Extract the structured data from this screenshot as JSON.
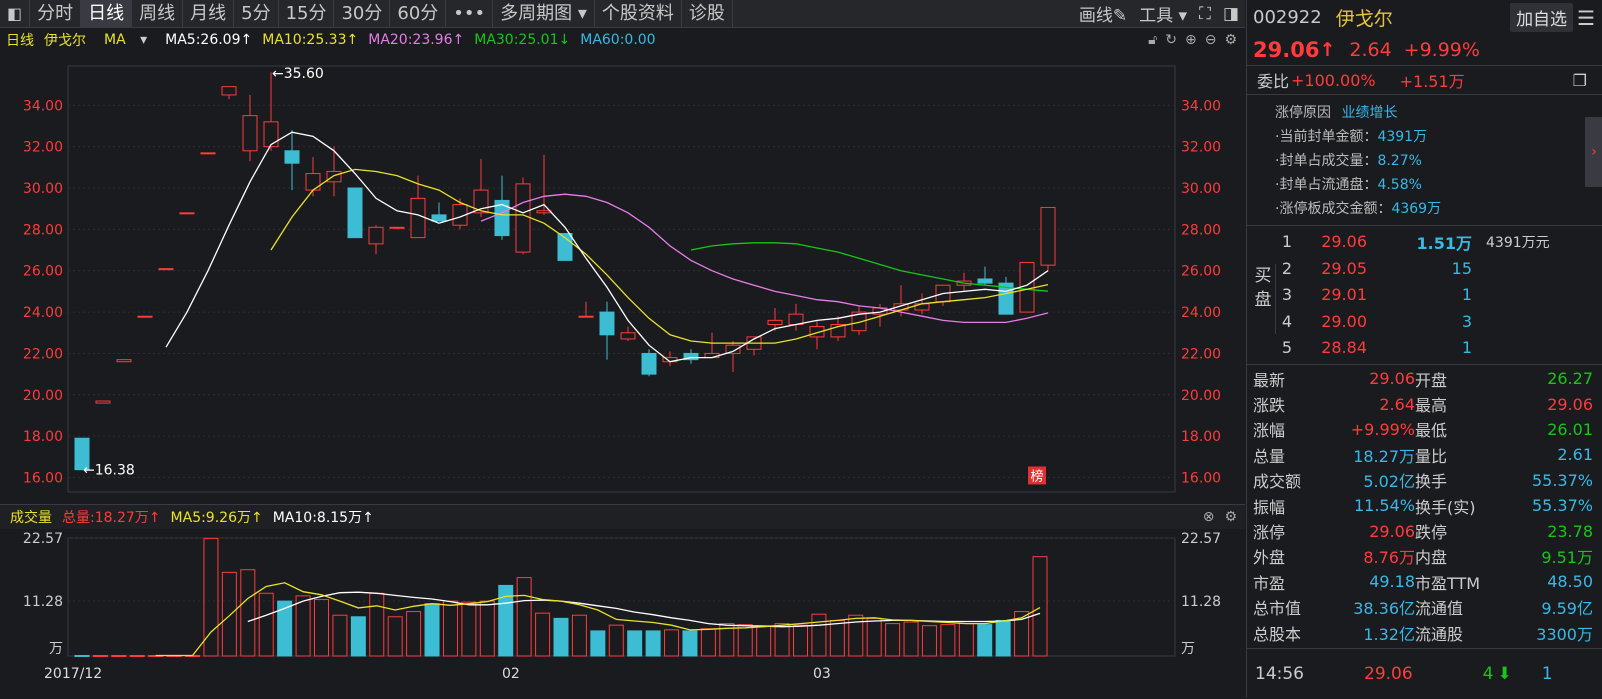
{
  "toolbar": {
    "tabs": [
      "分时",
      "日线",
      "周线",
      "月线",
      "5分",
      "15分",
      "30分",
      "60分",
      "•••",
      "多周期图 ▾",
      "个股资料",
      "诊股"
    ],
    "active": 1,
    "draw": "画线✎",
    "tools": "工具 ▾"
  },
  "ma_bar": {
    "period": "日线",
    "name": "伊戈尔",
    "ma_label": "MA",
    "ma5": "MA5:26.09↑",
    "ma10": "MA10:25.33↑",
    "ma20": "MA20:23.96↑",
    "ma30": "MA30:25.01↓",
    "ma60": "MA60:0.00"
  },
  "vol_bar": {
    "label": "成交量",
    "total": "总量:18.27万↑",
    "ma5": "MA5:9.26万↑",
    "ma10": "MA10:8.15万↑"
  },
  "colors": {
    "up": "#ff3b3b",
    "down": "#3dbdd4",
    "ma5": "#ffffff",
    "ma10": "#e8e22a",
    "ma20": "#e87ce8",
    "ma30": "#19c519"
  },
  "chart_data": {
    "type": "candlestick",
    "price_ticks": [
      "34.00",
      "32.00",
      "30.00",
      "28.00",
      "26.00",
      "24.00",
      "22.00",
      "20.00",
      "18.00",
      "16.00"
    ],
    "ylim": [
      15.3,
      35.9
    ],
    "high_label": "←35.60",
    "low_label": "←16.38",
    "x_labels": [
      "2017/12",
      "02",
      "03"
    ],
    "badge": "榜",
    "candles": [
      {
        "o": 17.9,
        "c": 16.38,
        "h": 17.9,
        "l": 16.38
      },
      {
        "o": 19.6,
        "c": 19.7,
        "h": 19.7,
        "l": 19.6
      },
      {
        "o": 21.6,
        "c": 21.7,
        "h": 21.7,
        "l": 21.6
      },
      {
        "o": 23.8,
        "c": 23.8,
        "h": 23.8,
        "l": 23.8
      },
      {
        "o": 26.1,
        "c": 26.1,
        "h": 26.1,
        "l": 26.1
      },
      {
        "o": 28.8,
        "c": 28.8,
        "h": 28.8,
        "l": 28.8
      },
      {
        "o": 31.7,
        "c": 31.7,
        "h": 31.7,
        "l": 31.7
      },
      {
        "o": 34.5,
        "c": 34.9,
        "h": 34.9,
        "l": 34.3
      },
      {
        "o": 31.8,
        "c": 33.5,
        "h": 34.5,
        "l": 31.3
      },
      {
        "o": 32.0,
        "c": 33.2,
        "h": 35.6,
        "l": 31.8
      },
      {
        "o": 31.8,
        "c": 31.2,
        "h": 32.8,
        "l": 29.9
      },
      {
        "o": 29.9,
        "c": 30.7,
        "h": 31.5,
        "l": 29.6
      },
      {
        "o": 30.3,
        "c": 30.8,
        "h": 32.0,
        "l": 29.6
      },
      {
        "o": 30.0,
        "c": 27.6,
        "h": 30.0,
        "l": 27.6
      },
      {
        "o": 27.3,
        "c": 28.1,
        "h": 28.2,
        "l": 26.8
      },
      {
        "o": 28.1,
        "c": 28.1,
        "h": 28.1,
        "l": 28.0
      },
      {
        "o": 27.6,
        "c": 29.5,
        "h": 30.6,
        "l": 27.6
      },
      {
        "o": 28.7,
        "c": 28.4,
        "h": 29.3,
        "l": 28.4
      },
      {
        "o": 28.2,
        "c": 29.2,
        "h": 29.5,
        "l": 28.0
      },
      {
        "o": 28.8,
        "c": 29.9,
        "h": 31.4,
        "l": 28.6
      },
      {
        "o": 29.4,
        "c": 27.7,
        "h": 30.6,
        "l": 27.5
      },
      {
        "o": 26.9,
        "c": 30.2,
        "h": 30.5,
        "l": 26.8
      },
      {
        "o": 28.8,
        "c": 28.9,
        "h": 31.6,
        "l": 28.7
      },
      {
        "o": 27.8,
        "c": 26.5,
        "h": 27.8,
        "l": 26.5
      },
      {
        "o": 23.8,
        "c": 23.8,
        "h": 24.5,
        "l": 23.8
      },
      {
        "o": 24.0,
        "c": 22.9,
        "h": 24.5,
        "l": 21.7
      },
      {
        "o": 22.7,
        "c": 23.0,
        "h": 23.3,
        "l": 22.6
      },
      {
        "o": 22.0,
        "c": 21.0,
        "h": 22.2,
        "l": 20.9
      },
      {
        "o": 21.6,
        "c": 21.8,
        "h": 22.1,
        "l": 21.4
      },
      {
        "o": 22.0,
        "c": 21.7,
        "h": 22.2,
        "l": 21.5
      },
      {
        "o": 21.8,
        "c": 22.0,
        "h": 23.0,
        "l": 21.8
      },
      {
        "o": 22.0,
        "c": 22.4,
        "h": 22.6,
        "l": 21.1
      },
      {
        "o": 22.2,
        "c": 22.8,
        "h": 22.8,
        "l": 21.9
      },
      {
        "o": 23.4,
        "c": 23.6,
        "h": 24.2,
        "l": 23.1
      },
      {
        "o": 23.4,
        "c": 23.9,
        "h": 24.4,
        "l": 23.1
      },
      {
        "o": 22.8,
        "c": 23.3,
        "h": 23.6,
        "l": 22.2
      },
      {
        "o": 22.8,
        "c": 23.4,
        "h": 23.8,
        "l": 22.6
      },
      {
        "o": 23.1,
        "c": 24.0,
        "h": 24.3,
        "l": 22.9
      },
      {
        "o": 23.9,
        "c": 24.2,
        "h": 24.4,
        "l": 23.3
      },
      {
        "o": 24.1,
        "c": 24.4,
        "h": 25.3,
        "l": 23.8
      },
      {
        "o": 24.1,
        "c": 24.4,
        "h": 24.9,
        "l": 23.9
      },
      {
        "o": 24.5,
        "c": 25.3,
        "h": 25.3,
        "l": 24.3
      },
      {
        "o": 25.3,
        "c": 25.5,
        "h": 25.9,
        "l": 25.0
      },
      {
        "o": 25.6,
        "c": 25.4,
        "h": 26.2,
        "l": 25.3
      },
      {
        "o": 25.4,
        "c": 23.9,
        "h": 25.7,
        "l": 23.9
      },
      {
        "o": 24.0,
        "c": 26.4,
        "h": 26.4,
        "l": 24.0
      },
      {
        "o": 26.27,
        "c": 29.06,
        "h": 29.06,
        "l": 26.01
      }
    ],
    "ma5": [
      null,
      null,
      null,
      null,
      22.3,
      24.0,
      26.0,
      28.2,
      30.3,
      32.1,
      32.7,
      32.5,
      31.8,
      30.7,
      29.5,
      28.9,
      28.7,
      28.3,
      28.6,
      29.0,
      29.2,
      28.8,
      29.2,
      28.1,
      26.6,
      25.2,
      23.6,
      22.4,
      21.6,
      21.8,
      21.8,
      22.1,
      22.7,
      23.2,
      23.4,
      23.6,
      23.7,
      23.9,
      24.0,
      24.3,
      24.6,
      24.9,
      25.0,
      25.1,
      25.0,
      25.3,
      26.0
    ],
    "ma10": [
      null,
      null,
      null,
      null,
      null,
      null,
      null,
      null,
      null,
      27.0,
      28.6,
      29.9,
      30.6,
      30.9,
      30.8,
      30.6,
      30.2,
      29.9,
      29.3,
      28.9,
      28.7,
      28.7,
      28.3,
      27.6,
      26.8,
      25.8,
      24.7,
      23.7,
      22.9,
      22.6,
      22.5,
      22.5,
      22.5,
      22.5,
      22.7,
      23.0,
      23.3,
      23.5,
      23.8,
      24.1,
      24.4,
      24.5,
      24.6,
      24.7,
      24.9,
      25.1,
      25.33
    ],
    "ma20": [
      null,
      null,
      null,
      null,
      null,
      null,
      null,
      null,
      null,
      null,
      null,
      null,
      null,
      null,
      null,
      null,
      null,
      null,
      null,
      28.4,
      28.8,
      29.3,
      29.6,
      29.7,
      29.6,
      29.3,
      28.8,
      28.1,
      27.2,
      26.5,
      26.0,
      25.6,
      25.3,
      25.0,
      24.8,
      24.6,
      24.5,
      24.3,
      24.2,
      24.0,
      23.8,
      23.6,
      23.5,
      23.5,
      23.5,
      23.7,
      23.96
    ],
    "ma30": [
      null,
      null,
      null,
      null,
      null,
      null,
      null,
      null,
      null,
      null,
      null,
      null,
      null,
      null,
      null,
      null,
      null,
      null,
      null,
      null,
      null,
      null,
      null,
      null,
      null,
      null,
      null,
      null,
      null,
      27.0,
      27.2,
      27.3,
      27.35,
      27.35,
      27.3,
      27.1,
      26.9,
      26.6,
      26.3,
      26.0,
      25.8,
      25.6,
      25.4,
      25.3,
      25.2,
      25.1,
      25.01
    ],
    "vol_ticks": [
      "22.57",
      "11.28",
      "万"
    ],
    "vol_ylim": [
      0,
      22.57
    ],
    "volume": [
      0.1,
      0.1,
      0.1,
      0.1,
      0.1,
      0.1,
      0.1,
      22.5,
      16.0,
      16.5,
      12.0,
      10.5,
      11.5,
      10.8,
      7.8,
      7.5,
      12.0,
      7.5,
      8.5,
      10.0,
      10.5,
      10.3,
      10.5,
      13.5,
      15.0,
      8.2,
      7.2,
      7.8,
      4.8,
      5.9,
      4.8,
      4.8,
      5.0,
      4.8,
      5.2,
      6.2,
      6.0,
      5.8,
      6.2,
      5.9,
      8.0,
      6.8,
      7.8,
      7.2,
      6.2,
      6.5,
      5.8,
      6.0,
      6.2,
      6.0,
      6.8,
      8.5,
      19.0
    ],
    "vol_ma5": [
      null,
      null,
      null,
      null,
      0.1,
      0.1,
      0.1,
      4.6,
      7.7,
      11.0,
      13.3,
      14.0,
      12.3,
      11.7,
      10.5,
      9.2,
      9.6,
      8.8,
      9.5,
      10.0,
      9.7,
      10.0,
      10.4,
      11.4,
      11.6,
      10.8,
      10.5,
      9.8,
      8.8,
      7.0,
      6.7,
      6.4,
      5.9,
      5.0,
      5.1,
      5.3,
      5.4,
      5.6,
      5.9,
      6.2,
      6.5,
      6.8,
      7.2,
      7.3,
      6.9,
      6.8,
      6.6,
      6.4,
      6.2,
      6.2,
      6.7,
      7.3,
      9.26
    ],
    "vol_ma10": [
      null,
      null,
      null,
      null,
      null,
      null,
      null,
      null,
      null,
      6.6,
      7.8,
      9.1,
      10.5,
      11.4,
      12.1,
      12.2,
      12.0,
      11.6,
      11.2,
      10.9,
      10.4,
      9.8,
      9.8,
      10.1,
      10.6,
      10.7,
      10.5,
      10.1,
      9.6,
      9.1,
      8.4,
      7.9,
      7.3,
      6.8,
      6.2,
      5.9,
      5.8,
      5.7,
      5.6,
      5.7,
      5.9,
      6.2,
      6.5,
      6.7,
      6.8,
      6.8,
      6.7,
      6.6,
      6.6,
      6.6,
      6.7,
      7.0,
      8.15
    ]
  },
  "quote": {
    "code": "002922",
    "name": "伊戈尔",
    "add": "加自选",
    "price": "29.06",
    "price_arrow": "↑",
    "change": "2.64",
    "pct": "+9.99%",
    "weibi_label": "委比",
    "weibi": "+100.00%",
    "weicha": "+1.51万",
    "reason_label": "涨停原因",
    "reason": "业绩增长",
    "seal_amt_label": "当前封单金额：",
    "seal_amt": "4391万",
    "seal_vol_label": "封单占成交量：",
    "seal_vol": "8.27%",
    "seal_float_label": "封单占流通盘：",
    "seal_float": "4.58%",
    "limit_turnover_label": "涨停板成交金额：",
    "limit_turnover": "4369万",
    "buy_label": "买盘",
    "bids": [
      {
        "n": "1",
        "p": "29.06",
        "q": "1.51万",
        "a": "4391万元"
      },
      {
        "n": "2",
        "p": "29.05",
        "q": "15",
        "a": ""
      },
      {
        "n": "3",
        "p": "29.01",
        "q": "1",
        "a": ""
      },
      {
        "n": "4",
        "p": "29.00",
        "q": "3",
        "a": ""
      },
      {
        "n": "5",
        "p": "28.84",
        "q": "1",
        "a": ""
      }
    ],
    "stats": [
      {
        "k1": "最新",
        "v1": "29.06",
        "c1": "red",
        "k2": "开盘",
        "v2": "26.27",
        "c2": "green"
      },
      {
        "k1": "涨跌",
        "v1": "2.64",
        "c1": "red",
        "k2": "最高",
        "v2": "29.06",
        "c2": "red"
      },
      {
        "k1": "涨幅",
        "v1": "+9.99%",
        "c1": "red",
        "k2": "最低",
        "v2": "26.01",
        "c2": "green"
      },
      {
        "k1": "总量",
        "v1": "18.27万",
        "c1": "blue",
        "k2": "量比",
        "v2": "2.61",
        "c2": "blue"
      },
      {
        "k1": "成交额",
        "v1": "5.02亿",
        "c1": "blue",
        "k2": "换手",
        "v2": "55.37%",
        "c2": "blue"
      },
      {
        "k1": "振幅",
        "v1": "11.54%",
        "c1": "blue",
        "k2": "换手(实)",
        "v2": "55.37%",
        "c2": "blue"
      },
      {
        "k1": "涨停",
        "v1": "29.06",
        "c1": "red",
        "k2": "跌停",
        "v2": "23.78",
        "c2": "green"
      },
      {
        "k1": "外盘",
        "v1": "8.76万",
        "c1": "red",
        "k2": "内盘",
        "v2": "9.51万",
        "c2": "green"
      },
      {
        "k1": "市盈",
        "v1": "49.18",
        "c1": "blue",
        "k2": "市盈TTM",
        "v2": "48.50",
        "c2": "blue"
      },
      {
        "k1": "总市值",
        "v1": "38.36亿",
        "c1": "blue",
        "k2": "流通值",
        "v2": "9.59亿",
        "c2": "blue"
      },
      {
        "k1": "总股本",
        "v1": "1.32亿",
        "c1": "blue",
        "k2": "流通股",
        "v2": "3300万",
        "c2": "blue"
      }
    ],
    "tick_time": "14:56",
    "tick_price": "29.06",
    "tick_vol": "4",
    "tick_arrow": "⬇",
    "tick_count": "1"
  }
}
